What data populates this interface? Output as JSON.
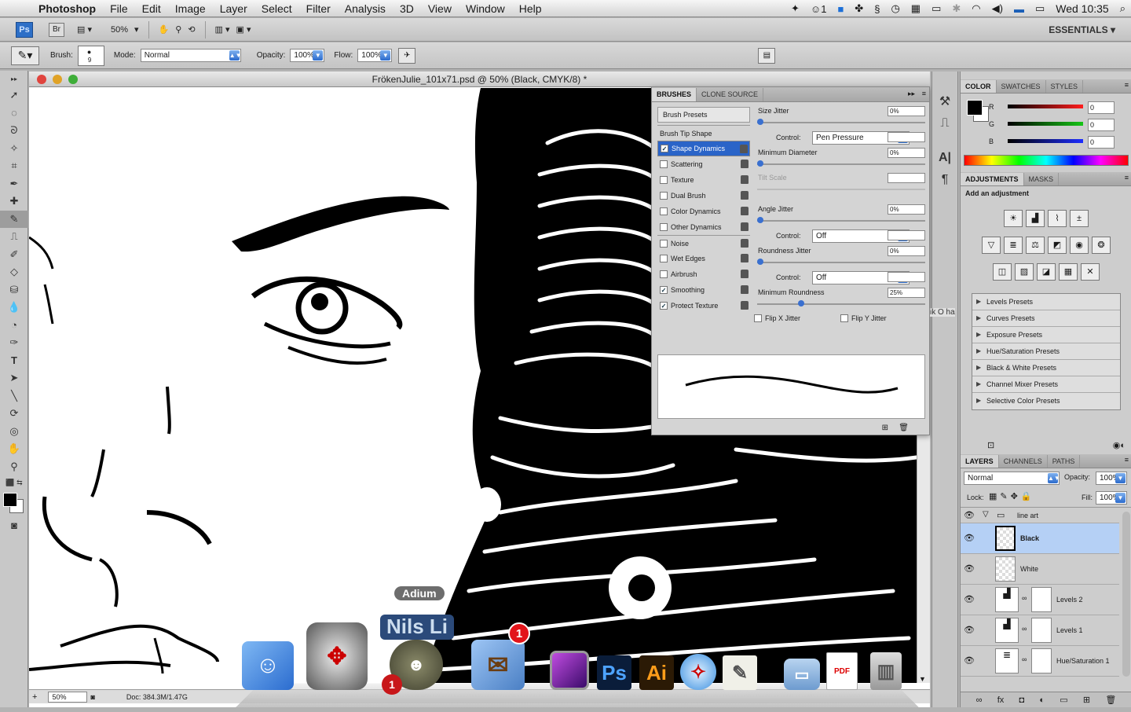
{
  "menubar": {
    "app": "Photoshop",
    "items": [
      "File",
      "Edit",
      "Image",
      "Layer",
      "Select",
      "Filter",
      "Analysis",
      "3D",
      "View",
      "Window",
      "Help"
    ],
    "status": {
      "badge_count": "1",
      "clock": "Wed 10:35"
    }
  },
  "appbar": {
    "ps": "Ps",
    "br": "Br",
    "zoom": "50%",
    "workspace": "ESSENTIALS ▾"
  },
  "options": {
    "brush_label": "Brush:",
    "brush_size": "9",
    "mode_label": "Mode:",
    "mode_value": "Normal",
    "opacity_label": "Opacity:",
    "opacity_value": "100%",
    "flow_label": "Flow:",
    "flow_value": "100%"
  },
  "document": {
    "title": "FrökenJulie_101x71.psd @ 50% (Black, CMYK/8) *",
    "zoom": "50%",
    "doc_info": "Doc: 384.3M/1.47G"
  },
  "brushes": {
    "tabs": [
      "BRUSHES",
      "CLONE SOURCE"
    ],
    "presets_btn": "Brush Presets",
    "tip_shape": "Brush Tip Shape",
    "options": [
      {
        "label": "Shape Dynamics",
        "checked": "✓"
      },
      {
        "label": "Scattering",
        "checked": ""
      },
      {
        "label": "Texture",
        "checked": ""
      },
      {
        "label": "Dual Brush",
        "checked": ""
      },
      {
        "label": "Color Dynamics",
        "checked": ""
      },
      {
        "label": "Other Dynamics",
        "checked": ""
      },
      {
        "label": "Noise",
        "checked": ""
      },
      {
        "label": "Wet Edges",
        "checked": ""
      },
      {
        "label": "Airbrush",
        "checked": ""
      },
      {
        "label": "Smoothing",
        "checked": "✓"
      },
      {
        "label": "Protect Texture",
        "checked": "✓"
      }
    ],
    "size_jitter": {
      "label": "Size Jitter",
      "value": "0%"
    },
    "control_label": "Control:",
    "control1": "Pen Pressure",
    "min_diameter": {
      "label": "Minimum Diameter",
      "value": "0%"
    },
    "tilt_scale": {
      "label": "Tilt Scale",
      "value": ""
    },
    "angle_jitter": {
      "label": "Angle Jitter",
      "value": "0%"
    },
    "control2": "Off",
    "roundness_jitter": {
      "label": "Roundness Jitter",
      "value": "0%"
    },
    "control3": "Off",
    "min_roundness": {
      "label": "Minimum Roundness",
      "value": "25%",
      "level": 0.25
    },
    "flip_x": "Flip X Jitter",
    "flip_y": "Flip Y Jitter"
  },
  "color_panel": {
    "tabs": [
      "COLOR",
      "SWATCHES",
      "STYLES"
    ],
    "channels": [
      {
        "label": "R",
        "value": "0",
        "color": "#e02020"
      },
      {
        "label": "G",
        "value": "0",
        "color": "#20b020"
      },
      {
        "label": "B",
        "value": "0",
        "color": "#2030e0"
      }
    ]
  },
  "adjustments": {
    "tabs": [
      "ADJUSTMENTS",
      "MASKS"
    ],
    "heading": "Add an adjustment",
    "presets": [
      "Levels Presets",
      "Curves Presets",
      "Exposure Presets",
      "Hue/Saturation Presets",
      "Black & White Presets",
      "Channel Mixer Presets",
      "Selective Color Presets"
    ]
  },
  "layers": {
    "tabs": [
      "LAYERS",
      "CHANNELS",
      "PATHS"
    ],
    "blend": "Normal",
    "opacity_label": "Opacity:",
    "opacity": "100%",
    "lock_label": "Lock:",
    "fill_label": "Fill:",
    "fill": "100%",
    "group": "line art",
    "items": [
      "Black",
      "White",
      "Levels 2",
      "Levels 1",
      "Hue/Saturation 1"
    ]
  },
  "dock": {
    "tooltip": "Adium",
    "adium_banner": "Nils Li",
    "mail_badge": "1",
    "adium_badge": "1",
    "ps": "Ps",
    "ai": "Ai"
  },
  "partial_text": "ik O ha",
  "colors": {
    "selection": "#2a64c8",
    "accent": "#3a70d0"
  }
}
